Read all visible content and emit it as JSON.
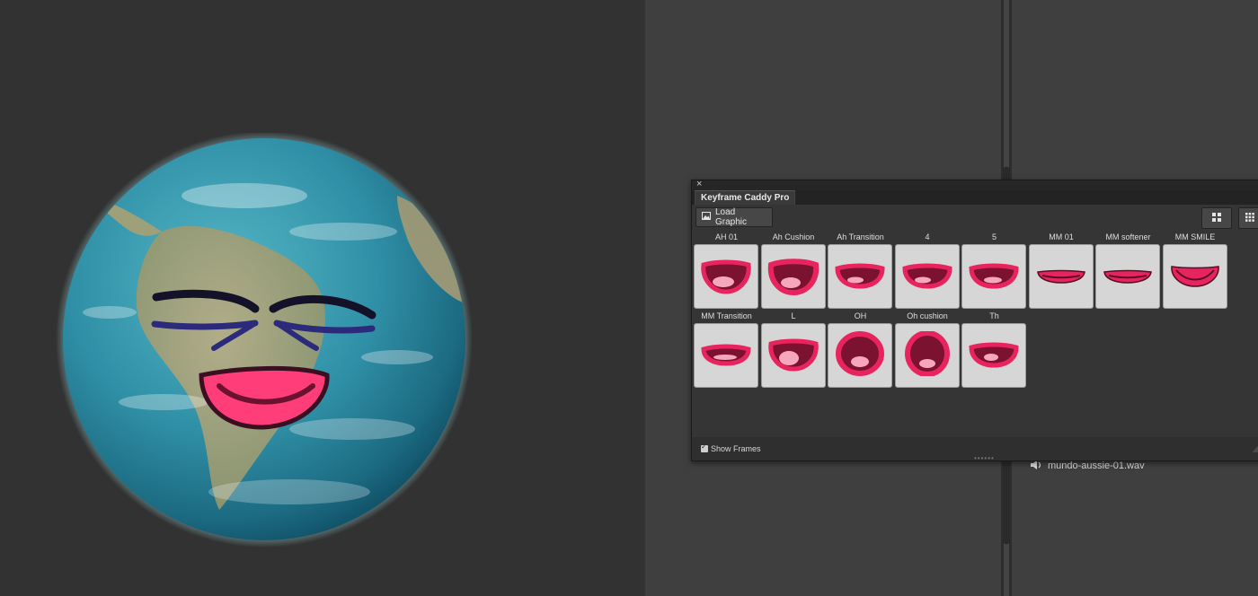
{
  "panel": {
    "title": "Keyframe Caddy Pro",
    "close_glyph": "×",
    "load_button": "Load Graphic",
    "show_frames_label": "Show Frames",
    "show_frames_checked": true
  },
  "mouths": [
    {
      "label": "AH 01",
      "shape": "open-wide"
    },
    {
      "label": "Ah Cushion",
      "shape": "open-cushion"
    },
    {
      "label": "Ah Transition",
      "shape": "open-half"
    },
    {
      "label": "4",
      "shape": "open-half"
    },
    {
      "label": "5",
      "shape": "open-half-tongue"
    },
    {
      "label": "MM 01",
      "shape": "closed-flat"
    },
    {
      "label": "MM softener",
      "shape": "closed-flat"
    },
    {
      "label": "MM SMILE",
      "shape": "closed-smile"
    },
    {
      "label": "MM Transition",
      "shape": "open-narrow"
    },
    {
      "label": "L",
      "shape": "open-l"
    },
    {
      "label": "OH",
      "shape": "oh"
    },
    {
      "label": "Oh cushion",
      "shape": "oh-tall"
    },
    {
      "label": "Th",
      "shape": "th"
    }
  ],
  "audio": {
    "file_name": "mundo-aussie-01.wav",
    "icon": "speaker-icon"
  },
  "colors": {
    "mouth_outline": "#e8245e",
    "mouth_dark": "#7a1230",
    "tongue": "#f7a7bd",
    "earth_glow": "#aef6ff"
  }
}
